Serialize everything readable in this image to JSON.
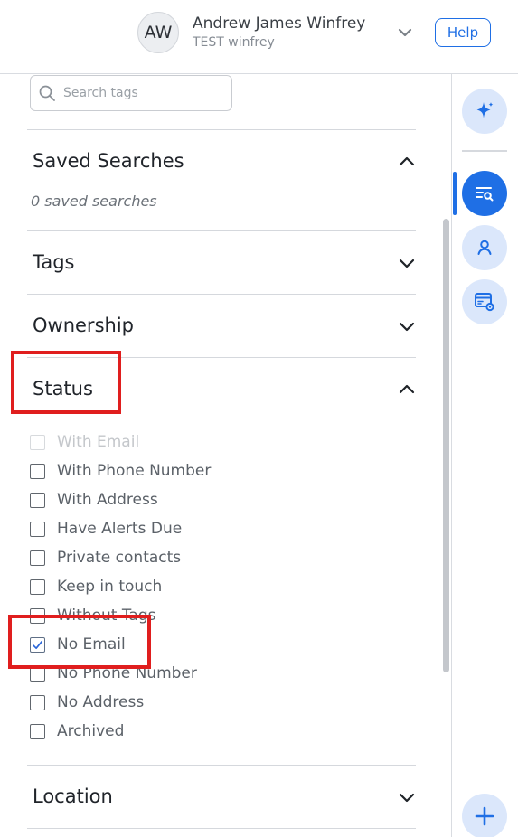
{
  "header": {
    "avatar_initials": "AW",
    "user_name": "Andrew James Winfrey",
    "org_name": "TEST winfrey",
    "help_label": "Help"
  },
  "search": {
    "placeholder": "Search tags",
    "value": ""
  },
  "sections": {
    "saved_searches": {
      "title": "Saved Searches",
      "expanded": true,
      "empty_text": "0 saved searches"
    },
    "tags": {
      "title": "Tags",
      "expanded": false
    },
    "ownership": {
      "title": "Ownership",
      "expanded": false
    },
    "status": {
      "title": "Status",
      "expanded": true,
      "options": [
        {
          "label": "With Email",
          "checked": false,
          "disabled": true
        },
        {
          "label": "With Phone Number",
          "checked": false,
          "disabled": false
        },
        {
          "label": "With Address",
          "checked": false,
          "disabled": false
        },
        {
          "label": "Have Alerts Due",
          "checked": false,
          "disabled": false
        },
        {
          "label": "Private contacts",
          "checked": false,
          "disabled": false
        },
        {
          "label": "Keep in touch",
          "checked": false,
          "disabled": false
        },
        {
          "label": "Without Tags",
          "checked": false,
          "disabled": false
        },
        {
          "label": "No Email",
          "checked": true,
          "disabled": false
        },
        {
          "label": "No Phone Number",
          "checked": false,
          "disabled": false
        },
        {
          "label": "No Address",
          "checked": false,
          "disabled": false
        },
        {
          "label": "Archived",
          "checked": false,
          "disabled": false
        }
      ]
    },
    "location": {
      "title": "Location",
      "expanded": false
    }
  },
  "rail": {
    "items": [
      {
        "icon": "sparkle-icon",
        "active": false
      },
      {
        "icon": "search-list-icon",
        "active": true
      },
      {
        "icon": "person-icon",
        "active": false
      },
      {
        "icon": "card-settings-icon",
        "active": false
      },
      {
        "icon": "plus-icon",
        "active": false
      }
    ]
  },
  "colors": {
    "accent": "#1f6fe5",
    "rail_bg": "#dbe7fb",
    "highlight": "#e01e1e"
  }
}
